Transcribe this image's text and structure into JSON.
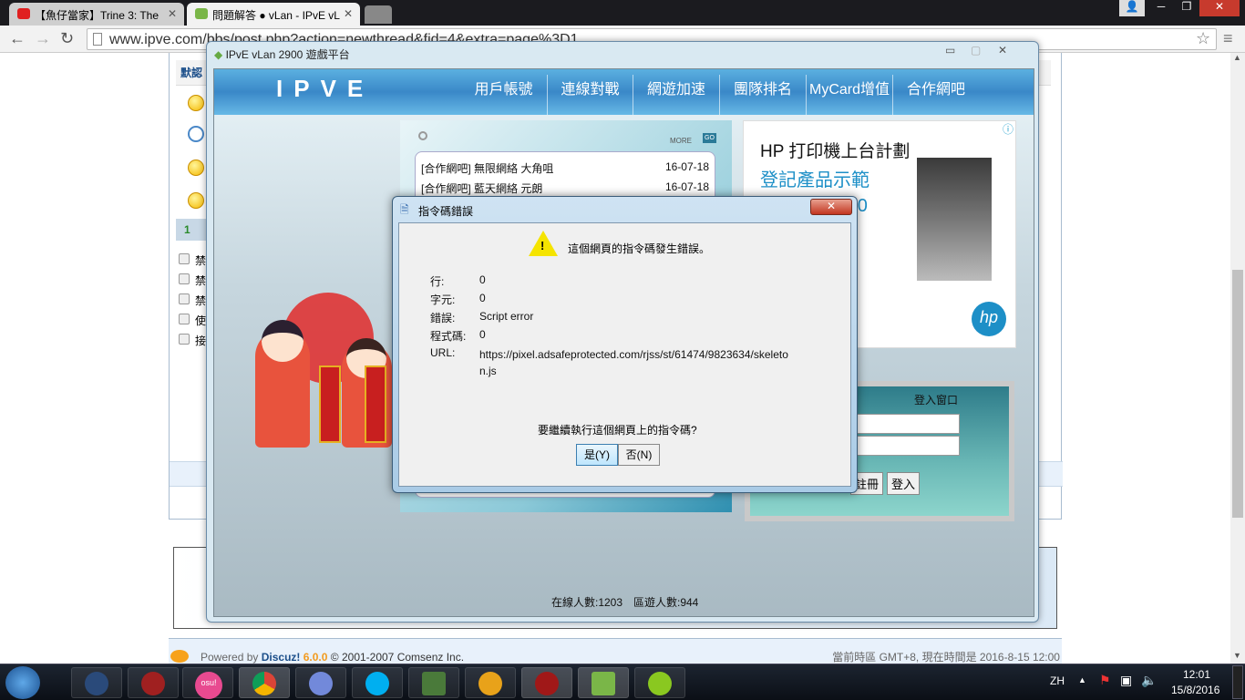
{
  "browser": {
    "tabs": [
      {
        "label": "【魚仔當家】Trine 3: The",
        "active": false
      },
      {
        "label": "問題解答 ● vLan - IPvE vL",
        "active": false
      }
    ],
    "url": "www.ipve.com/bbs/post.php?action=newthread&fid=4&extra=page%3D1"
  },
  "forum": {
    "header_label": "默認",
    "page_number": "1",
    "checkbox_labels": [
      "禁",
      "禁",
      "禁",
      "使",
      "接"
    ],
    "footer": {
      "powered": "Powered by",
      "brand": "Discuz!",
      "version": "6.0.0",
      "copyright": "© 2001-2007 Comsenz Inc.",
      "time": "當前時區 GMT+8, 現在時間是 2016-8-15 12:00"
    }
  },
  "app": {
    "title": "IPvE vLan 2900 遊戲平台",
    "logo": "IPVE",
    "nav": [
      "用戶帳號",
      "連線對戰",
      "網遊加速",
      "團隊排名",
      "MyCard增值",
      "合作網吧"
    ],
    "news_more": "MORE",
    "news_go": "GO",
    "news": [
      {
        "title": "[合作網吧] 無限網絡 大角咀",
        "date": "16-07-18"
      },
      {
        "title": "[合作網吧] 藍天網絡 元朗",
        "date": "16-07-18"
      }
    ],
    "ad": {
      "title": "HP 打印機上台計劃",
      "subtitle": "登記產品示範",
      "line3": "即送 HK$300",
      "brand": "hp"
    },
    "login": {
      "title": "登入窗口",
      "register": "註冊",
      "login": "登入"
    },
    "status": {
      "online": "在線人數:1203",
      "zone": "區遊人數:944"
    }
  },
  "dialog": {
    "title": "指令碼錯誤",
    "message": "這個網頁的指令碼發生錯誤。",
    "fields": [
      {
        "label": "行:",
        "value": "0"
      },
      {
        "label": "字元:",
        "value": "0"
      },
      {
        "label": "錯誤:",
        "value": "Script error"
      },
      {
        "label": "程式碼:",
        "value": "0"
      },
      {
        "label": "URL:",
        "value": "https://pixel.adsafeprotected.com/rjss/st/61474/9823634/skeleton.js"
      }
    ],
    "question": "要繼續執行這個網頁上的指令碼?",
    "yes": "是(Y)",
    "no": "否(N)"
  },
  "taskbar": {
    "lang": "ZH",
    "time": "12:01",
    "date": "15/8/2016",
    "osu": "osu!"
  }
}
